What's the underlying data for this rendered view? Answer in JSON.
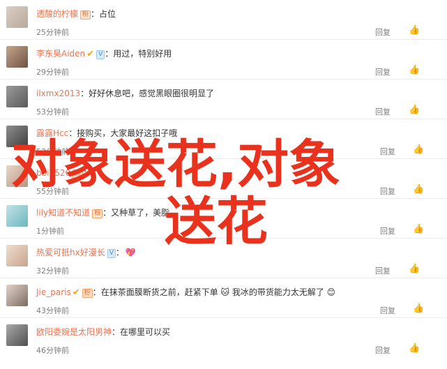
{
  "comments": [
    {
      "name": "透酸的柠檬",
      "badge": "粉",
      "badge_type": "fans",
      "text": "占位",
      "time": "25分钟前",
      "reply": "回复",
      "like": "👍"
    },
    {
      "name": "李东昊Aiden",
      "verified": true,
      "badge": "V",
      "badge_type": "vip",
      "text": "用过，特别好用",
      "time": "29分钟前",
      "reply": "回复",
      "like": "👍"
    },
    {
      "name": "ilxmx2013",
      "text": "好好休息吧，感觉黑眼圈很明显了",
      "time": "53分钟前",
      "reply": "回复",
      "like": "👍"
    },
    {
      "name": "露露Hcc",
      "text": "接购买，大家最好这扣子哦",
      "time": "53分钟前",
      "reply": "回复",
      "like": "👍"
    },
    {
      "name": "bbi0520",
      "badge": "粉",
      "badge_type": "fans",
      "text": "",
      "time": "55分钟前",
      "reply": "回复",
      "like": "👍"
    },
    {
      "name": "lily知道不知道",
      "badge": "粉",
      "badge_type": "fans",
      "text": "又种草了，美脂",
      "time": "1分钟前",
      "reply": "回复",
      "like": "👍"
    },
    {
      "name": "热爱可抵hx好漫长",
      "badge": "V",
      "badge_type": "vip",
      "text": "💖",
      "time": "32分钟前",
      "reply": "回复",
      "like": "👍"
    },
    {
      "name": "Jie_paris",
      "verified": true,
      "badge": "粉",
      "badge_type": "fans",
      "text": "在抹茶面膜断货之前，赶紧下单 🐱 我冰的带货能力太无解了 😊",
      "time": "43分钟前",
      "reply": "回复",
      "like": "👍"
    },
    {
      "name": "欧阳委婉是太阳男神",
      "text": "在哪里可以买",
      "time": "46分钟前",
      "reply": "回复",
      "like": "👍"
    }
  ],
  "overlay": {
    "line1": "对象送花,对象",
    "line2": "送花"
  },
  "colors": {
    "username": "#eb7350",
    "overlay": "#e8321d",
    "meta": "#808080"
  }
}
